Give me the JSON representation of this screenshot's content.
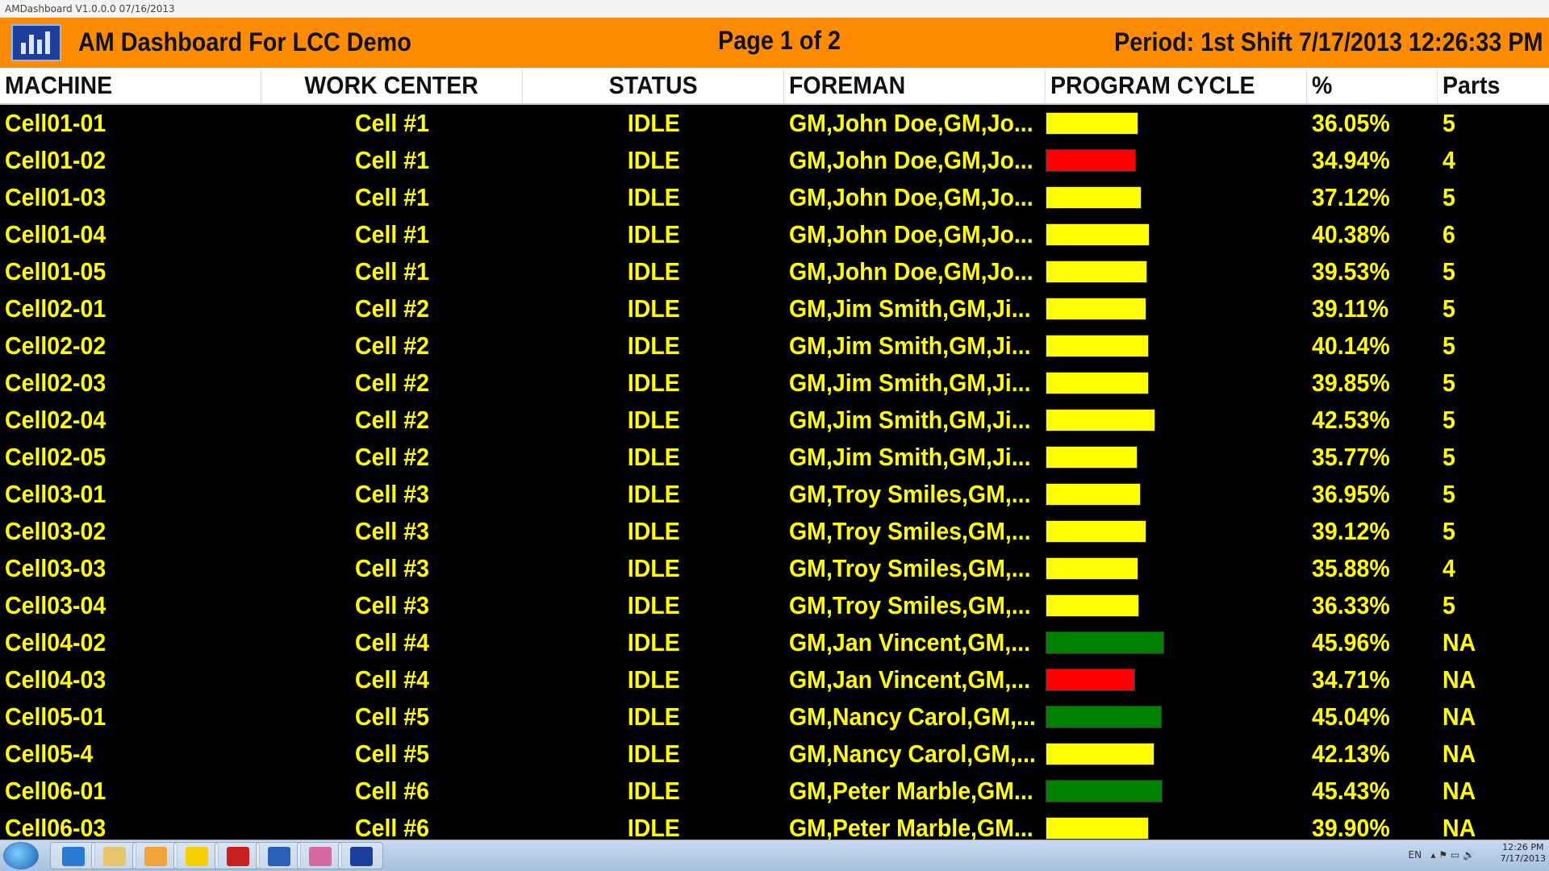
{
  "window": {
    "title": "AMDashboard V1.0.0.0 07/16/2013"
  },
  "header": {
    "logo_icon": "bar-chart-icon",
    "title": "AM Dashboard For LCC Demo",
    "page": "Page 1 of 2",
    "period": "Period: 1st Shift  7/17/2013 12:26:33 PM",
    "background": "#ff8c00"
  },
  "columns": [
    "MACHINE",
    "WORK CENTER",
    "STATUS",
    "FOREMAN",
    "PROGRAM CYCLE",
    "%",
    "Parts"
  ],
  "colors": {
    "text": "#ffff00",
    "yellow": "#ffff00",
    "red": "#ff0000",
    "green": "#008000"
  },
  "rows": [
    {
      "machine": "Cell01-01",
      "work_center": "Cell #1",
      "status": "IDLE",
      "foreman": "GM,John Doe,GM,Jo...",
      "cycle_pct": 36.05,
      "cycle_color": "yellow",
      "percent": "36.05%",
      "parts": "5"
    },
    {
      "machine": "Cell01-02",
      "work_center": "Cell #1",
      "status": "IDLE",
      "foreman": "GM,John Doe,GM,Jo...",
      "cycle_pct": 34.94,
      "cycle_color": "red",
      "percent": "34.94%",
      "parts": "4"
    },
    {
      "machine": "Cell01-03",
      "work_center": "Cell #1",
      "status": "IDLE",
      "foreman": "GM,John Doe,GM,Jo...",
      "cycle_pct": 37.12,
      "cycle_color": "yellow",
      "percent": "37.12%",
      "parts": "5"
    },
    {
      "machine": "Cell01-04",
      "work_center": "Cell #1",
      "status": "IDLE",
      "foreman": "GM,John Doe,GM,Jo...",
      "cycle_pct": 40.38,
      "cycle_color": "yellow",
      "percent": "40.38%",
      "parts": "6"
    },
    {
      "machine": "Cell01-05",
      "work_center": "Cell #1",
      "status": "IDLE",
      "foreman": "GM,John Doe,GM,Jo...",
      "cycle_pct": 39.53,
      "cycle_color": "yellow",
      "percent": "39.53%",
      "parts": "5"
    },
    {
      "machine": "Cell02-01",
      "work_center": "Cell #2",
      "status": "IDLE",
      "foreman": "GM,Jim Smith,GM,Ji...",
      "cycle_pct": 39.11,
      "cycle_color": "yellow",
      "percent": "39.11%",
      "parts": "5"
    },
    {
      "machine": "Cell02-02",
      "work_center": "Cell #2",
      "status": "IDLE",
      "foreman": "GM,Jim Smith,GM,Ji...",
      "cycle_pct": 40.14,
      "cycle_color": "yellow",
      "percent": "40.14%",
      "parts": "5"
    },
    {
      "machine": "Cell02-03",
      "work_center": "Cell #2",
      "status": "IDLE",
      "foreman": "GM,Jim Smith,GM,Ji...",
      "cycle_pct": 39.85,
      "cycle_color": "yellow",
      "percent": "39.85%",
      "parts": "5"
    },
    {
      "machine": "Cell02-04",
      "work_center": "Cell #2",
      "status": "IDLE",
      "foreman": "GM,Jim Smith,GM,Ji...",
      "cycle_pct": 42.53,
      "cycle_color": "yellow",
      "percent": "42.53%",
      "parts": "5"
    },
    {
      "machine": "Cell02-05",
      "work_center": "Cell #2",
      "status": "IDLE",
      "foreman": "GM,Jim Smith,GM,Ji...",
      "cycle_pct": 35.77,
      "cycle_color": "yellow",
      "percent": "35.77%",
      "parts": "5"
    },
    {
      "machine": "Cell03-01",
      "work_center": "Cell #3",
      "status": "IDLE",
      "foreman": "GM,Troy Smiles,GM,...",
      "cycle_pct": 36.95,
      "cycle_color": "yellow",
      "percent": "36.95%",
      "parts": "5"
    },
    {
      "machine": "Cell03-02",
      "work_center": "Cell #3",
      "status": "IDLE",
      "foreman": "GM,Troy Smiles,GM,...",
      "cycle_pct": 39.12,
      "cycle_color": "yellow",
      "percent": "39.12%",
      "parts": "5"
    },
    {
      "machine": "Cell03-03",
      "work_center": "Cell #3",
      "status": "IDLE",
      "foreman": "GM,Troy Smiles,GM,...",
      "cycle_pct": 35.88,
      "cycle_color": "yellow",
      "percent": "35.88%",
      "parts": "4"
    },
    {
      "machine": "Cell03-04",
      "work_center": "Cell #3",
      "status": "IDLE",
      "foreman": "GM,Troy Smiles,GM,...",
      "cycle_pct": 36.33,
      "cycle_color": "yellow",
      "percent": "36.33%",
      "parts": "5"
    },
    {
      "machine": "Cell04-02",
      "work_center": "Cell #4",
      "status": "IDLE",
      "foreman": "GM,Jan Vincent,GM,...",
      "cycle_pct": 45.96,
      "cycle_color": "green",
      "percent": "45.96%",
      "parts": "NA"
    },
    {
      "machine": "Cell04-03",
      "work_center": "Cell #4",
      "status": "IDLE",
      "foreman": "GM,Jan Vincent,GM,...",
      "cycle_pct": 34.71,
      "cycle_color": "red",
      "percent": "34.71%",
      "parts": "NA"
    },
    {
      "machine": "Cell05-01",
      "work_center": "Cell #5",
      "status": "IDLE",
      "foreman": "GM,Nancy Carol,GM,...",
      "cycle_pct": 45.04,
      "cycle_color": "green",
      "percent": "45.04%",
      "parts": "NA"
    },
    {
      "machine": "Cell05-4",
      "work_center": "Cell #5",
      "status": "IDLE",
      "foreman": "GM,Nancy Carol,GM,...",
      "cycle_pct": 42.13,
      "cycle_color": "yellow",
      "percent": "42.13%",
      "parts": "NA"
    },
    {
      "machine": "Cell06-01",
      "work_center": "Cell #6",
      "status": "IDLE",
      "foreman": "GM,Peter Marble,GM...",
      "cycle_pct": 45.43,
      "cycle_color": "green",
      "percent": "45.43%",
      "parts": "NA"
    },
    {
      "machine": "Cell06-03",
      "work_center": "Cell #6",
      "status": "IDLE",
      "foreman": "GM,Peter Marble,GM...",
      "cycle_pct": 39.9,
      "cycle_color": "yellow",
      "percent": "39.90%",
      "parts": "NA"
    }
  ],
  "taskbar": {
    "items": [
      "internet-explorer-icon",
      "file-explorer-icon",
      "outlook-icon",
      "z-app-icon",
      "cg-app-icon",
      "word-icon",
      "paint-icon",
      "amdashboard-icon"
    ],
    "language": "EN",
    "time": "12:26 PM",
    "date": "7/17/2013"
  }
}
